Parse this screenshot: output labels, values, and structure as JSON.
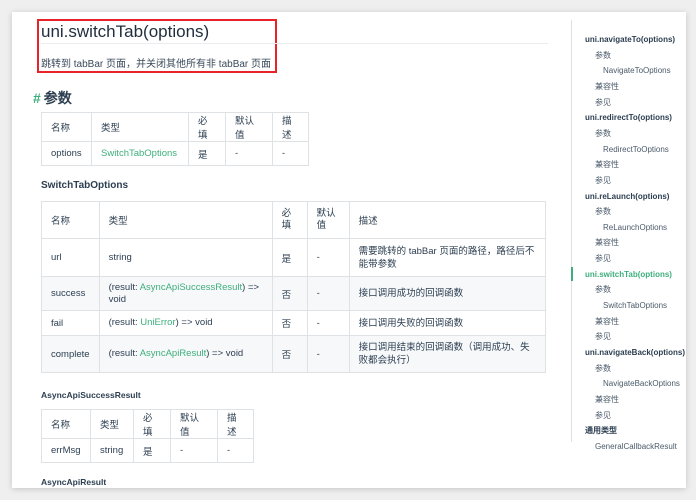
{
  "title": "uni.switchTab(options)",
  "description": "跳转到 tabBar 页面，并关闭其他所有非 tabBar 页面",
  "section_params": "参数",
  "hash": "#",
  "headers": [
    "名称",
    "类型",
    "必填",
    "默认值",
    "描述"
  ],
  "params_table": {
    "rows": [
      {
        "name": "options",
        "type": "SwitchTabOptions",
        "required": "是",
        "default": "-",
        "desc": "-"
      }
    ]
  },
  "switch_tab_options": {
    "title": "SwitchTabOptions",
    "rows": [
      {
        "name": "url",
        "type_pre": "string",
        "type_link": "",
        "type_post": "",
        "required": "是",
        "default": "-",
        "desc": "需要跳转的 tabBar 页面的路径，路径后不能带参数"
      },
      {
        "name": "success",
        "type_pre": "(result: ",
        "type_link": "AsyncApiSuccessResult",
        "type_post": ") => void",
        "required": "否",
        "default": "-",
        "desc": "接口调用成功的回调函数"
      },
      {
        "name": "fail",
        "type_pre": "(result: ",
        "type_link": "UniError",
        "type_post": ") => void",
        "required": "否",
        "default": "-",
        "desc": "接口调用失败的回调函数"
      },
      {
        "name": "complete",
        "type_pre": "(result: ",
        "type_link": "AsyncApiResult",
        "type_post": ") => void",
        "required": "否",
        "default": "-",
        "desc": "接口调用结束的回调函数（调用成功、失败都会执行）"
      }
    ]
  },
  "async_success": {
    "title": "AsyncApiSuccessResult",
    "rows": [
      {
        "name": "errMsg",
        "type": "string",
        "required": "是",
        "default": "-",
        "desc": "-"
      }
    ]
  },
  "async_result": {
    "title": "AsyncApiResult"
  },
  "toc": [
    {
      "label": "uni.navigateTo(options)",
      "level": 0
    },
    {
      "label": "参数",
      "level": 1
    },
    {
      "label": "NavigateToOptions",
      "level": 2
    },
    {
      "label": "兼容性",
      "level": 1
    },
    {
      "label": "参见",
      "level": 1
    },
    {
      "label": "uni.redirectTo(options)",
      "level": 0
    },
    {
      "label": "参数",
      "level": 1
    },
    {
      "label": "RedirectToOptions",
      "level": 2
    },
    {
      "label": "兼容性",
      "level": 1
    },
    {
      "label": "参见",
      "level": 1
    },
    {
      "label": "uni.reLaunch(options)",
      "level": 0
    },
    {
      "label": "参数",
      "level": 1
    },
    {
      "label": "ReLaunchOptions",
      "level": 2
    },
    {
      "label": "兼容性",
      "level": 1
    },
    {
      "label": "参见",
      "level": 1
    },
    {
      "label": "uni.switchTab(options)",
      "level": 0,
      "active": true
    },
    {
      "label": "参数",
      "level": 1
    },
    {
      "label": "SwitchTabOptions",
      "level": 2
    },
    {
      "label": "兼容性",
      "level": 1
    },
    {
      "label": "参见",
      "level": 1
    },
    {
      "label": "uni.navigateBack(options)",
      "level": 0
    },
    {
      "label": "参数",
      "level": 1
    },
    {
      "label": "NavigateBackOptions",
      "level": 2
    },
    {
      "label": "兼容性",
      "level": 1
    },
    {
      "label": "参见",
      "level": 1
    },
    {
      "label": "通用类型",
      "level": 0
    },
    {
      "label": "GeneralCallbackResult",
      "level": 1
    }
  ],
  "colors": {
    "accent": "#3eaf7c",
    "highlight": "#e8242a"
  }
}
